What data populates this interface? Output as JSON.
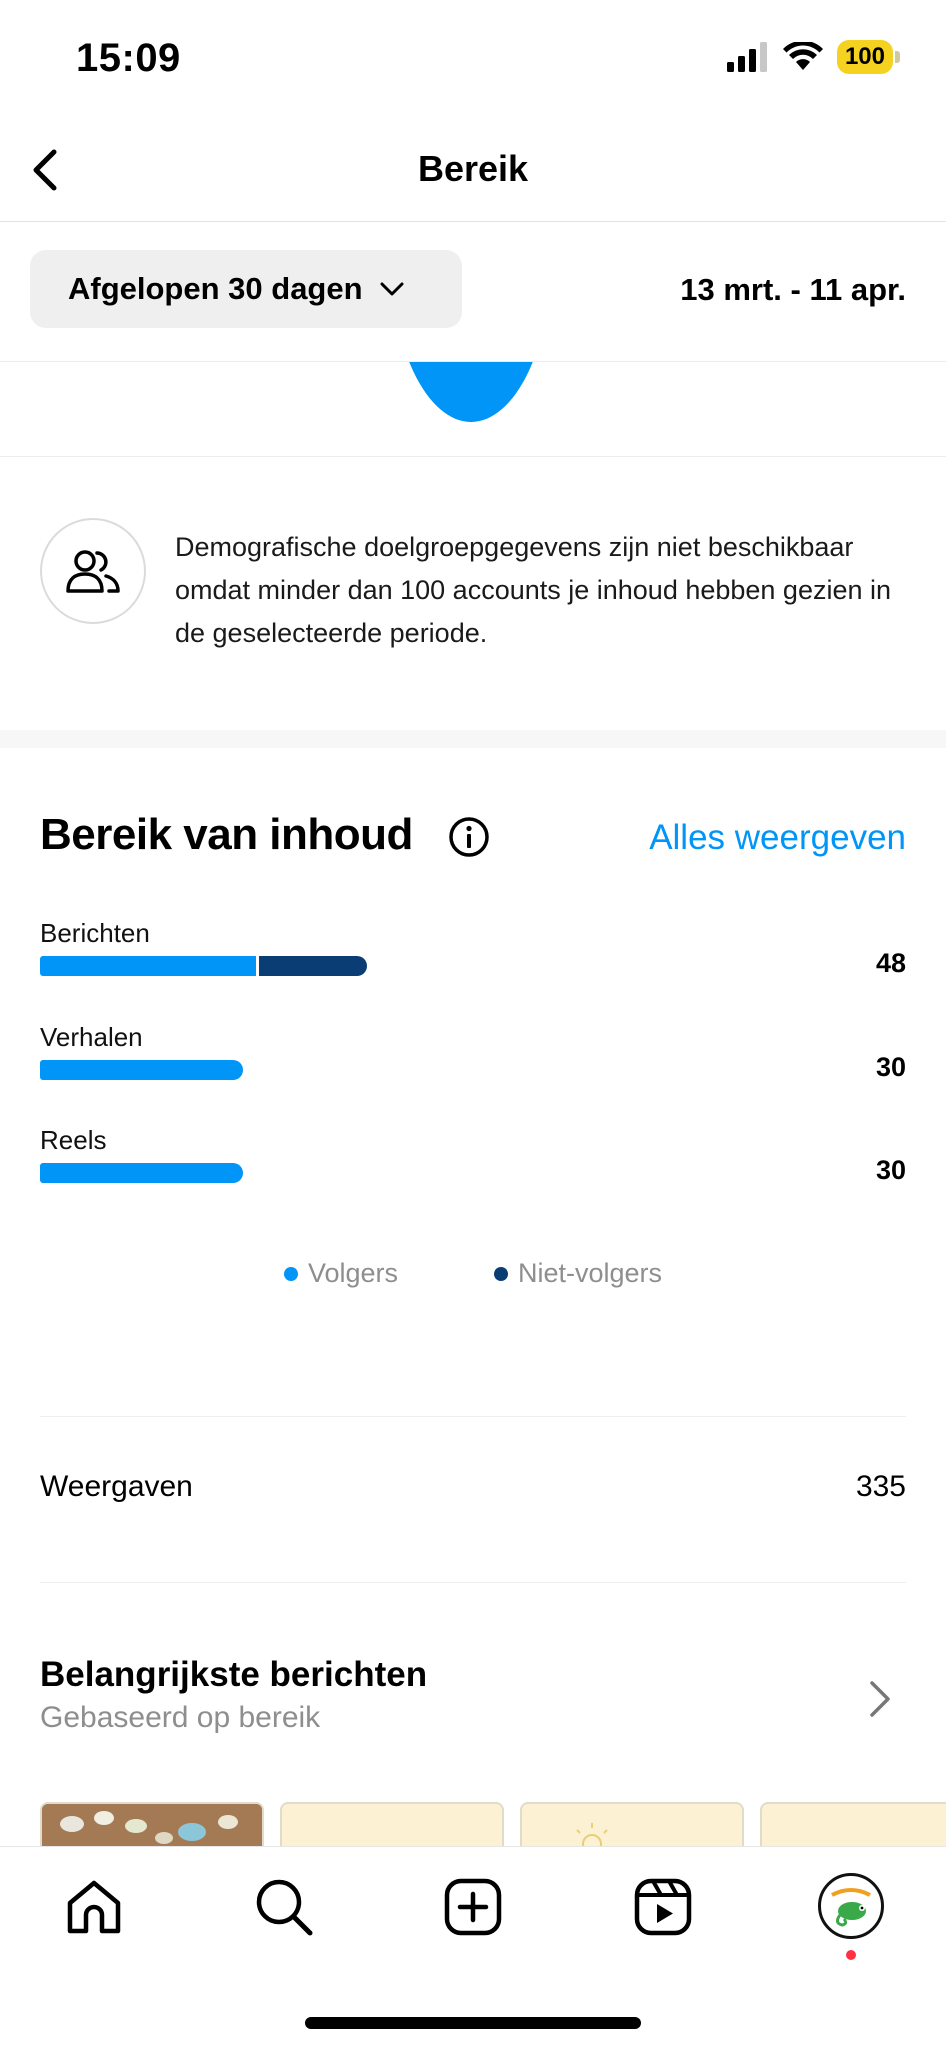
{
  "status_bar": {
    "time": "15:09",
    "battery": "100",
    "icons": [
      "cellular-signal-icon",
      "wifi-icon",
      "battery-icon"
    ]
  },
  "header": {
    "title": "Bereik",
    "back_icon": "back-arrow-icon"
  },
  "filter": {
    "period_label": "Afgelopen 30 dagen",
    "date_range": "13 mrt. - 11 apr."
  },
  "demographics": {
    "icon": "people-icon",
    "message": "Demografische doelgroepgegevens zijn niet beschikbaar omdat minder dan 100 accounts je inhoud hebben gezien in de geselecteerde periode."
  },
  "content_reach": {
    "title": "Bereik van inhoud",
    "see_all": "Alles weergeven",
    "rows": [
      {
        "label": "Berichten",
        "value": "48",
        "followers": 32,
        "non_followers": 16
      },
      {
        "label": "Verhalen",
        "value": "30",
        "followers": 30,
        "non_followers": 0
      },
      {
        "label": "Reels",
        "value": "30",
        "followers": 30,
        "non_followers": 0
      }
    ],
    "legend": [
      {
        "label": "Volgers",
        "color": "#0095f6"
      },
      {
        "label": "Niet-volgers",
        "color": "#0a3d73"
      }
    ]
  },
  "chart_data": {
    "type": "bar",
    "title": "Bereik van inhoud",
    "categories": [
      "Berichten",
      "Verhalen",
      "Reels"
    ],
    "series": [
      {
        "name": "Volgers",
        "values": [
          32,
          30,
          30
        ]
      },
      {
        "name": "Niet-volgers",
        "values": [
          16,
          0,
          0
        ]
      }
    ],
    "totals": [
      48,
      30,
      30
    ],
    "stacked": true,
    "orientation": "horizontal",
    "legend": "bottom-center"
  },
  "views": {
    "label": "Weergaven",
    "value": "335"
  },
  "top_posts": {
    "title": "Belangrijkste berichten",
    "subtitle": "Gebaseerd op bereik"
  },
  "tab_bar": {
    "tabs": [
      "home-icon",
      "search-icon",
      "create-icon",
      "reels-icon",
      "profile-avatar"
    ]
  },
  "colors": {
    "accent": "#0095f6",
    "non_followers": "#0a3d73",
    "notification": "#ff3040"
  }
}
